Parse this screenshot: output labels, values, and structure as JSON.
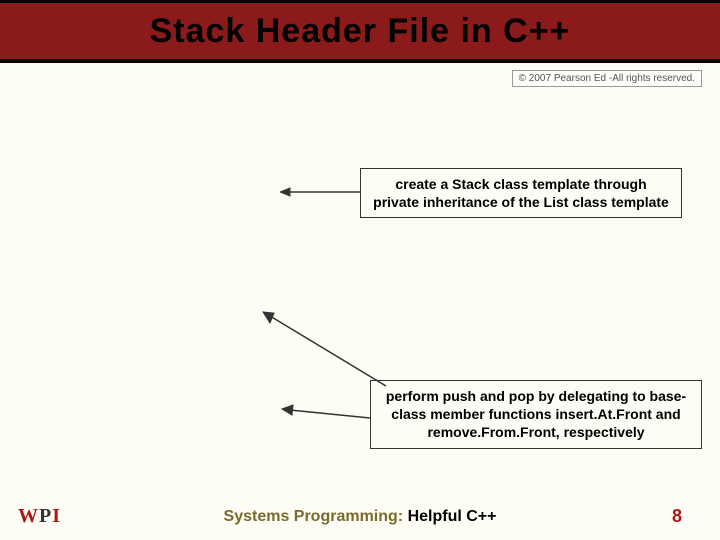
{
  "title": "Stack Header File in C++",
  "copyright": "© 2007 Pearson Ed -All rights reserved.",
  "callout1": "create a Stack class template through private inheritance of the List class template",
  "callout2": "perform push and pop by delegating to base-class member functions insert.At.Front and remove.From.Front, respectively",
  "footer_label": "Systems Programming:",
  "footer_topic": " Helpful C++",
  "page_number": "8",
  "logo_text": "WPI"
}
